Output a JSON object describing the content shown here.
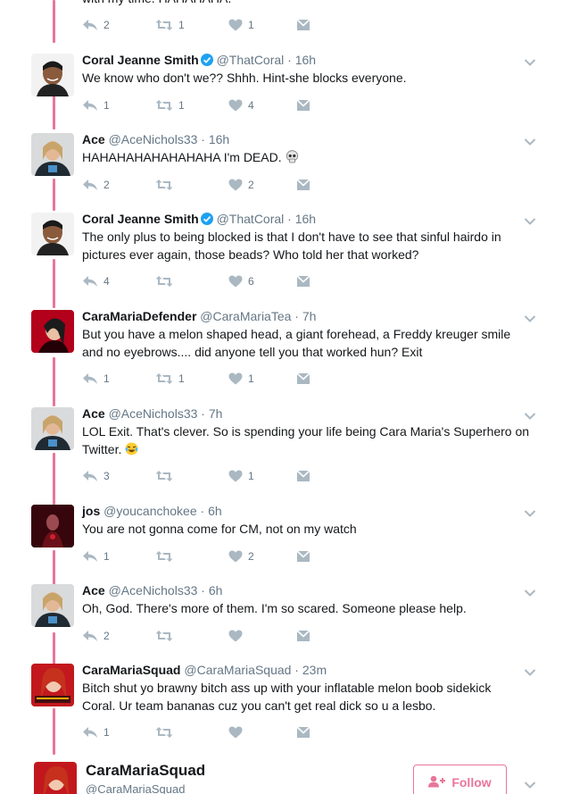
{
  "colors": {
    "accent": "#e8769a",
    "muted": "#657786",
    "verified": "#1da1f2"
  },
  "top_partial": {
    "text": "with my time. HAHAHAHA.",
    "reply_count": "2",
    "retweet_count": "1",
    "like_count": "1"
  },
  "tweets": [
    {
      "name": "Coral Jeanne Smith",
      "verified": true,
      "handle": "@ThatCoral",
      "time": "16h",
      "text": "We know who don't we?? Shhh. Hint-she blocks everyone.",
      "reply_count": "1",
      "retweet_count": "1",
      "like_count": "4",
      "avatar": "coral-avatar"
    },
    {
      "name": "Ace",
      "verified": false,
      "handle": "@AceNichols33",
      "time": "16h",
      "text": "HAHAHAHAHAHAHAHA I'm DEAD.",
      "emoji": "skull-emoji",
      "reply_count": "2",
      "retweet_count": "",
      "like_count": "2",
      "avatar": "ace-avatar"
    },
    {
      "name": "Coral Jeanne Smith",
      "verified": true,
      "handle": "@ThatCoral",
      "time": "16h",
      "text_lines": [
        "The only plus to being blocked is that I don't have to see that sinful hairdo in",
        "pictures ever again, those beads? Who told her that worked?"
      ],
      "reply_count": "4",
      "retweet_count": "",
      "like_count": "6",
      "avatar": "coral-avatar"
    },
    {
      "name": "CaraMariaDefender",
      "verified": false,
      "handle": "@CaraMariaTea",
      "time": "7h",
      "text_lines": [
        "But you have a melon shaped head, a giant forehead, a Freddy kreuger smile",
        "and no eyebrows.... did anyone tell you that worked hun? Exit"
      ],
      "reply_count": "1",
      "retweet_count": "1",
      "like_count": "1",
      "avatar": "defender-avatar"
    },
    {
      "name": "Ace",
      "verified": false,
      "handle": "@AceNichols33",
      "time": "7h",
      "text_lines": [
        "LOL Exit. That's clever. So is spending your life being Cara Maria's Superhero on",
        "Twitter."
      ],
      "emoji": "laughing-emoji",
      "reply_count": "3",
      "retweet_count": "",
      "like_count": "1",
      "avatar": "ace-avatar"
    },
    {
      "name": "jos",
      "verified": false,
      "handle": "@youcanchokee",
      "time": "6h",
      "text": "You are not gonna come for CM, not on my watch",
      "reply_count": "1",
      "retweet_count": "",
      "like_count": "2",
      "avatar": "jos-avatar"
    },
    {
      "name": "Ace",
      "verified": false,
      "handle": "@AceNichols33",
      "time": "6h",
      "text": "Oh, God. There's more of them. I'm so scared. Someone please help.",
      "reply_count": "2",
      "retweet_count": "",
      "like_count": "",
      "avatar": "ace-avatar"
    },
    {
      "name": "CaraMariaSquad",
      "verified": false,
      "handle": "@CaraMariaSquad",
      "time": "23m",
      "text_lines": [
        "Bitch shut yo brawny bitch ass up with your inflatable melon boob sidekick",
        "Coral. Ur team bananas cuz you can't get real dick so u a lesbo."
      ],
      "reply_count": "1",
      "retweet_count": "",
      "like_count": "",
      "avatar": "squad-avatar"
    }
  ],
  "follow_card": {
    "name": "CaraMariaSquad",
    "handle": "@CaraMariaSquad",
    "follow_label": "Follow"
  }
}
